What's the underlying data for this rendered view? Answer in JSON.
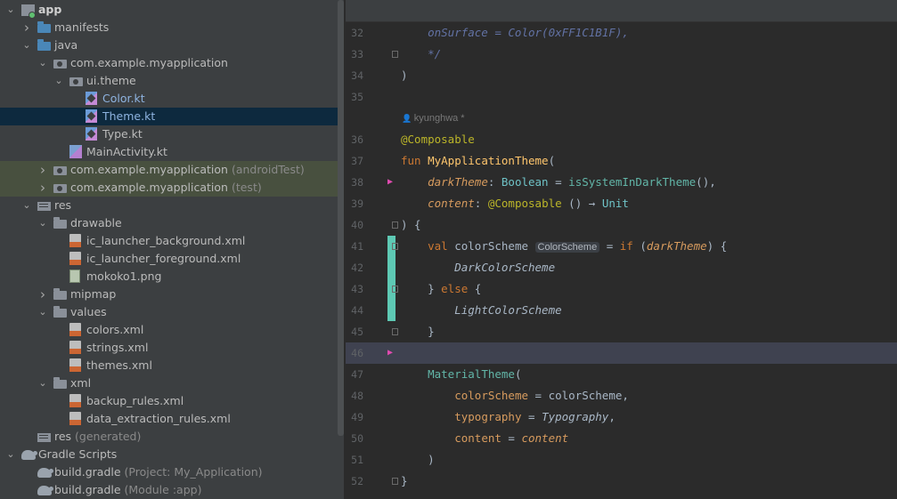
{
  "project_tree": {
    "rows": [
      {
        "label": "app",
        "extra": "",
        "depth": 0,
        "arrow": "open",
        "icon": "module-icon",
        "style": "bold",
        "bg": ""
      },
      {
        "label": "manifests",
        "extra": "",
        "depth": 1,
        "arrow": "closed",
        "icon": "folder-blue",
        "style": "",
        "bg": ""
      },
      {
        "label": "java",
        "extra": "",
        "depth": 1,
        "arrow": "open",
        "icon": "folder-blue",
        "style": "",
        "bg": ""
      },
      {
        "label": "com.example.myapplication",
        "extra": "",
        "depth": 2,
        "arrow": "open",
        "icon": "pkg",
        "style": "",
        "bg": ""
      },
      {
        "label": "ui.theme",
        "extra": "",
        "depth": 3,
        "arrow": "open",
        "icon": "pkg",
        "style": "",
        "bg": ""
      },
      {
        "label": "Color.kt",
        "extra": "",
        "depth": 4,
        "arrow": "none",
        "icon": "kt-file",
        "style": "kt-blue",
        "bg": ""
      },
      {
        "label": "Theme.kt",
        "extra": "",
        "depth": 4,
        "arrow": "none",
        "icon": "kt-file",
        "style": "kt-blue",
        "bg": "selected"
      },
      {
        "label": "Type.kt",
        "extra": "",
        "depth": 4,
        "arrow": "none",
        "icon": "kt-file",
        "style": "",
        "bg": ""
      },
      {
        "label": "MainActivity.kt",
        "extra": "",
        "depth": 3,
        "arrow": "none",
        "icon": "mainact-icon",
        "style": "",
        "bg": ""
      },
      {
        "label": "com.example.myapplication",
        "extra": "(androidTest)",
        "depth": 2,
        "arrow": "closed",
        "icon": "pkg",
        "style": "",
        "bg": "test-bg"
      },
      {
        "label": "com.example.myapplication",
        "extra": "(test)",
        "depth": 2,
        "arrow": "closed",
        "icon": "pkg",
        "style": "",
        "bg": "test-bg"
      },
      {
        "label": "res",
        "extra": "",
        "depth": 1,
        "arrow": "open",
        "icon": "res-folder",
        "style": "",
        "bg": ""
      },
      {
        "label": "drawable",
        "extra": "",
        "depth": 2,
        "arrow": "open",
        "icon": "folder-plain",
        "style": "",
        "bg": ""
      },
      {
        "label": "ic_launcher_background.xml",
        "extra": "",
        "depth": 3,
        "arrow": "none",
        "icon": "xml-file",
        "style": "",
        "bg": ""
      },
      {
        "label": "ic_launcher_foreground.xml",
        "extra": "",
        "depth": 3,
        "arrow": "none",
        "icon": "xml-file",
        "style": "",
        "bg": ""
      },
      {
        "label": "mokoko1.png",
        "extra": "",
        "depth": 3,
        "arrow": "none",
        "icon": "png-file",
        "style": "",
        "bg": ""
      },
      {
        "label": "mipmap",
        "extra": "",
        "depth": 2,
        "arrow": "closed",
        "icon": "folder-plain",
        "style": "",
        "bg": ""
      },
      {
        "label": "values",
        "extra": "",
        "depth": 2,
        "arrow": "open",
        "icon": "folder-plain",
        "style": "",
        "bg": ""
      },
      {
        "label": "colors.xml",
        "extra": "",
        "depth": 3,
        "arrow": "none",
        "icon": "xml-file",
        "style": "",
        "bg": ""
      },
      {
        "label": "strings.xml",
        "extra": "",
        "depth": 3,
        "arrow": "none",
        "icon": "xml-file",
        "style": "",
        "bg": ""
      },
      {
        "label": "themes.xml",
        "extra": "",
        "depth": 3,
        "arrow": "none",
        "icon": "xml-file",
        "style": "",
        "bg": ""
      },
      {
        "label": "xml",
        "extra": "",
        "depth": 2,
        "arrow": "open",
        "icon": "folder-plain",
        "style": "",
        "bg": ""
      },
      {
        "label": "backup_rules.xml",
        "extra": "",
        "depth": 3,
        "arrow": "none",
        "icon": "xml-file",
        "style": "",
        "bg": ""
      },
      {
        "label": "data_extraction_rules.xml",
        "extra": "",
        "depth": 3,
        "arrow": "none",
        "icon": "xml-file",
        "style": "",
        "bg": ""
      },
      {
        "label": "res",
        "extra": "(generated)",
        "depth": 1,
        "arrow": "none",
        "icon": "res-folder",
        "style": "",
        "bg": ""
      },
      {
        "label": "Gradle Scripts",
        "extra": "",
        "depth": 0,
        "arrow": "open",
        "icon": "gradle-icon",
        "style": "",
        "bg": ""
      },
      {
        "label": "build.gradle",
        "extra": "(Project: My_Application)",
        "depth": 1,
        "arrow": "none",
        "icon": "gradle-icon",
        "style": "",
        "bg": ""
      },
      {
        "label": "build.gradle",
        "extra": "(Module :app)",
        "depth": 1,
        "arrow": "none",
        "icon": "gradle-icon",
        "style": "",
        "bg": ""
      }
    ]
  },
  "editor": {
    "lines": [
      {
        "num": "32",
        "tokens": [
          {
            "t": "    onSurface = Color(0xFF1C1B1F),",
            "c": "c-comment"
          }
        ],
        "gutter": ""
      },
      {
        "num": "33",
        "tokens": [
          {
            "t": "    */",
            "c": "c-comment"
          }
        ],
        "gutter": "fold"
      },
      {
        "num": "34",
        "tokens": [
          {
            "t": ")",
            "c": ""
          }
        ],
        "gutter": ""
      },
      {
        "num": "35",
        "tokens": [],
        "gutter": ""
      },
      {
        "num": "",
        "author": "kyunghwa *",
        "tokens": [],
        "gutter": ""
      },
      {
        "num": "36",
        "tokens": [
          {
            "t": "@Composable",
            "c": "c-ann"
          }
        ],
        "gutter": ""
      },
      {
        "num": "37",
        "tokens": [
          {
            "t": "fun ",
            "c": "c-kw"
          },
          {
            "t": "MyApplicationTheme",
            "c": "c-fn"
          },
          {
            "t": "(",
            "c": ""
          }
        ],
        "gutter": ""
      },
      {
        "num": "38",
        "tokens": [
          {
            "t": "    ",
            "c": ""
          },
          {
            "t": "darkTheme",
            "c": "c-param"
          },
          {
            "t": ": ",
            "c": ""
          },
          {
            "t": "Boolean",
            "c": "c-type"
          },
          {
            "t": " = ",
            "c": ""
          },
          {
            "t": "isSystemInDarkTheme",
            "c": "c-compose"
          },
          {
            "t": "(),",
            "c": ""
          }
        ],
        "gutter": "pink"
      },
      {
        "num": "39",
        "tokens": [
          {
            "t": "    ",
            "c": ""
          },
          {
            "t": "content",
            "c": "c-param"
          },
          {
            "t": ": ",
            "c": ""
          },
          {
            "t": "@Composable",
            "c": "c-ann"
          },
          {
            "t": " () → ",
            "c": ""
          },
          {
            "t": "Unit",
            "c": "c-type"
          }
        ],
        "gutter": ""
      },
      {
        "num": "40",
        "tokens": [
          {
            "t": ") {",
            "c": ""
          }
        ],
        "gutter": "fold"
      },
      {
        "num": "41",
        "tokens": [
          {
            "t": "    ",
            "c": ""
          },
          {
            "t": "val ",
            "c": "c-kw"
          },
          {
            "t": "colorScheme",
            "c": ""
          },
          {
            "t": "INLAY",
            "c": "inlay"
          },
          {
            "t": " = ",
            "c": ""
          },
          {
            "t": "if",
            "c": "c-kw"
          },
          {
            "t": " (",
            "c": ""
          },
          {
            "t": "darkTheme",
            "c": "c-param"
          },
          {
            "t": ") {",
            "c": ""
          }
        ],
        "gutter": "change-fold"
      },
      {
        "num": "42",
        "tokens": [
          {
            "t": "        ",
            "c": ""
          },
          {
            "t": "DarkColorScheme",
            "c": "c-ital"
          }
        ],
        "gutter": "change"
      },
      {
        "num": "43",
        "tokens": [
          {
            "t": "    } ",
            "c": ""
          },
          {
            "t": "else",
            "c": "c-kw"
          },
          {
            "t": " {",
            "c": ""
          }
        ],
        "gutter": "change-fold"
      },
      {
        "num": "44",
        "tokens": [
          {
            "t": "        ",
            "c": ""
          },
          {
            "t": "LightColorScheme",
            "c": "c-ital"
          }
        ],
        "gutter": "change"
      },
      {
        "num": "45",
        "tokens": [
          {
            "t": "    }",
            "c": ""
          }
        ],
        "gutter": "fold"
      },
      {
        "num": "46",
        "tokens": [],
        "gutter": "pink-current"
      },
      {
        "num": "47",
        "tokens": [
          {
            "t": "    ",
            "c": ""
          },
          {
            "t": "MaterialTheme",
            "c": "c-compose"
          },
          {
            "t": "(",
            "c": ""
          }
        ],
        "gutter": ""
      },
      {
        "num": "48",
        "tokens": [
          {
            "t": "        ",
            "c": ""
          },
          {
            "t": "colorScheme",
            "c": "c-named"
          },
          {
            "t": " = colorScheme,",
            "c": ""
          }
        ],
        "gutter": ""
      },
      {
        "num": "49",
        "tokens": [
          {
            "t": "        ",
            "c": ""
          },
          {
            "t": "typography",
            "c": "c-named"
          },
          {
            "t": " = ",
            "c": ""
          },
          {
            "t": "Typography",
            "c": "c-ital"
          },
          {
            "t": ",",
            "c": ""
          }
        ],
        "gutter": ""
      },
      {
        "num": "50",
        "tokens": [
          {
            "t": "        ",
            "c": ""
          },
          {
            "t": "content",
            "c": "c-named"
          },
          {
            "t": " = ",
            "c": ""
          },
          {
            "t": "content",
            "c": "c-param"
          }
        ],
        "gutter": ""
      },
      {
        "num": "51",
        "tokens": [
          {
            "t": "    )",
            "c": ""
          }
        ],
        "gutter": ""
      },
      {
        "num": "52",
        "tokens": [
          {
            "t": "}",
            "c": ""
          }
        ],
        "gutter": "fold"
      }
    ],
    "inlay_hint": "ColorScheme"
  }
}
